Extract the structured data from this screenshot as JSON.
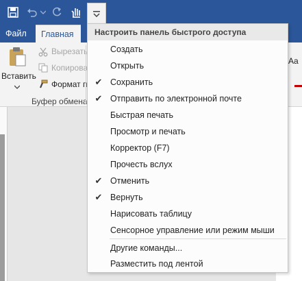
{
  "tabs": {
    "file": "Файл",
    "home": "Главная"
  },
  "clipboard": {
    "paste_label": "Вставить",
    "cut_label": "Вырезать",
    "copy_label": "Копирова",
    "format_painter_label": "Формат п",
    "group_label": "Буфер обмена"
  },
  "font_group": {
    "sample_label": "Aa"
  },
  "menu": {
    "title": "Настроить панель быстрого доступа",
    "items": [
      {
        "label": "Создать",
        "checked": false
      },
      {
        "label": "Открыть",
        "checked": false
      },
      {
        "label": "Сохранить",
        "checked": true
      },
      {
        "label": "Отправить по электронной почте",
        "checked": true
      },
      {
        "label": "Быстрая печать",
        "checked": false
      },
      {
        "label": "Просмотр и печать",
        "checked": false
      },
      {
        "label": "Корректор (F7)",
        "checked": false
      },
      {
        "label": "Прочесть вслух",
        "checked": false
      },
      {
        "label": "Отменить",
        "checked": true
      },
      {
        "label": "Вернуть",
        "checked": true
      },
      {
        "label": "Нарисовать таблицу",
        "checked": false
      },
      {
        "label": "Сенсорное управление или режим мыши",
        "checked": false
      },
      {
        "label": "Другие команды...",
        "checked": false
      },
      {
        "label": "Разместить под лентой",
        "checked": false
      }
    ]
  },
  "colors": {
    "brand": "#2b579a",
    "ribbon": "#f3f3f3",
    "accent_red": "#c00000"
  }
}
